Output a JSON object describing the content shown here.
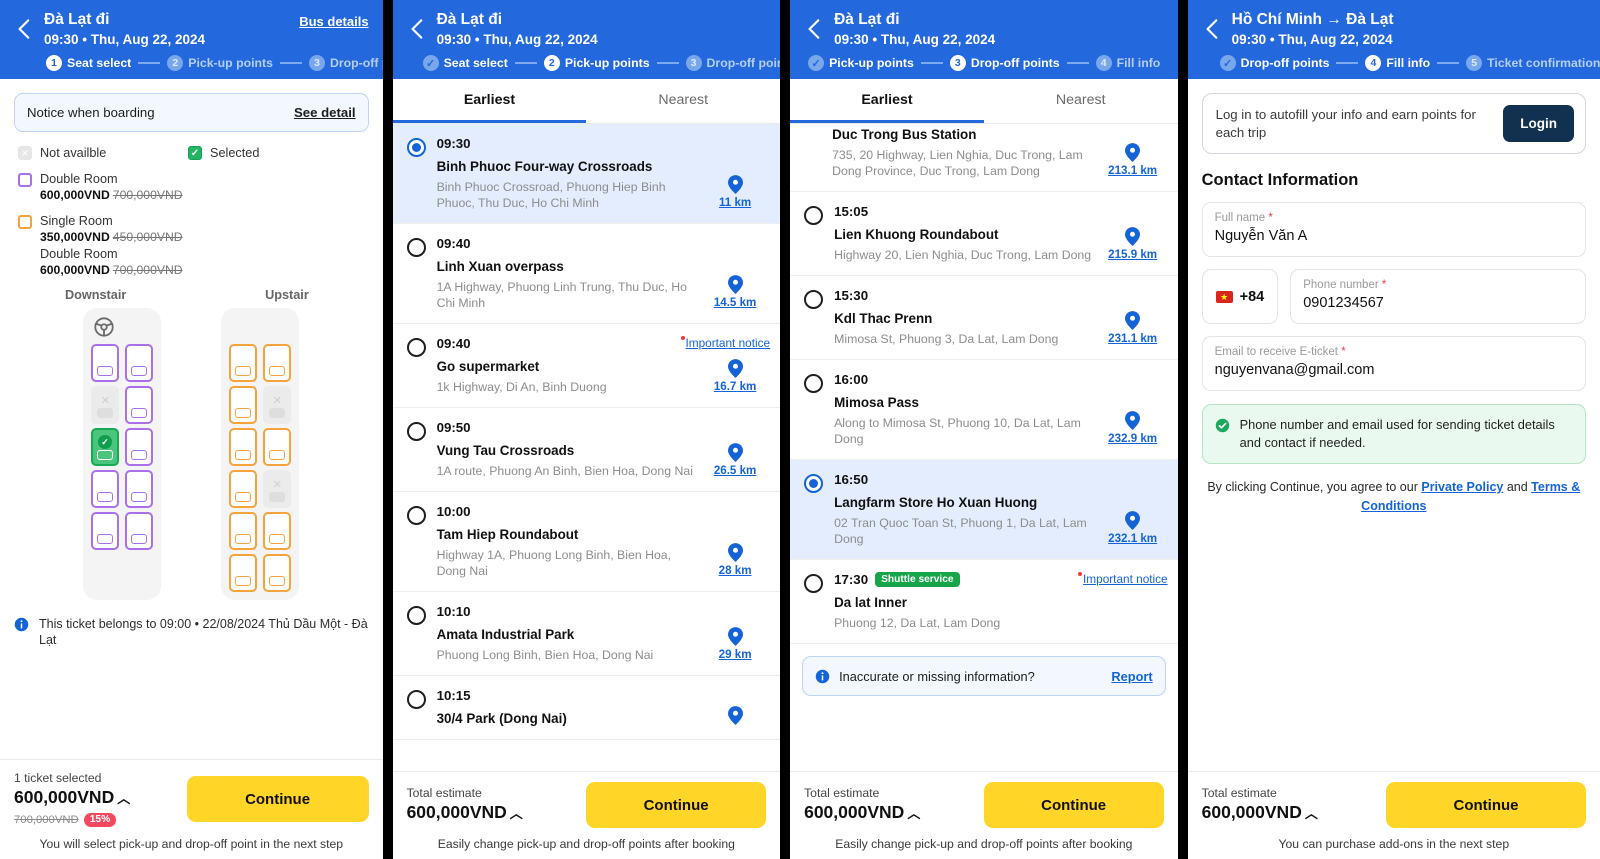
{
  "panel1": {
    "header": {
      "title": "Đà Lạt đi",
      "subtitle": "09:30 • Thu, Aug 22, 2024",
      "action": "Bus details",
      "steps": [
        {
          "num": "1",
          "label": "Seat select",
          "state": "current"
        },
        {
          "num": "2",
          "label": "Pick-up points",
          "state": "todo"
        },
        {
          "num": "3",
          "label": "Drop-off points",
          "state": "todo"
        }
      ]
    },
    "notice": {
      "text": "Notice when boarding",
      "action": "See detail"
    },
    "legend": {
      "not_available": "Not availble",
      "selected": "Selected",
      "groups": [
        {
          "color": "#a970e8",
          "lines": [
            {
              "name": "Double Room",
              "price": "600,000VND",
              "old_price": "700,000VND"
            }
          ]
        },
        {
          "color": "#f5a33c",
          "lines": [
            {
              "name": "Single Room",
              "price": "350,000VND",
              "old_price": "450,000VND"
            },
            {
              "name": "Double Room",
              "price": "600,000VND",
              "old_price": "700,000VND"
            }
          ]
        }
      ]
    },
    "decks": {
      "downstair_label": "Downstair",
      "upstair_label": "Upstair",
      "downstair": [
        [
          "free",
          "free"
        ],
        [
          "na",
          "free"
        ],
        [
          "selected",
          "free"
        ],
        [
          "free",
          "free"
        ],
        [
          "free",
          "free"
        ]
      ],
      "upstair": [
        [
          "free",
          "free"
        ],
        [
          "free",
          "na"
        ],
        [
          "free",
          "free"
        ],
        [
          "free",
          "na"
        ],
        [
          "free",
          "free"
        ],
        [
          "free",
          "free"
        ]
      ]
    },
    "ticket_note": "This ticket belongs to 09:00 • 22/08/2024 Thủ Dầu Một - Đà Lạt",
    "footer": {
      "caption": "1 ticket selected",
      "amount": "600,000VND",
      "old_price": "700,000VND",
      "discount": "15%",
      "continue": "Continue",
      "hint": "You will select pick-up and drop-off point in the next step"
    }
  },
  "panel2": {
    "header": {
      "title": "Đà Lạt đi",
      "subtitle": "09:30 • Thu, Aug 22, 2024",
      "steps": [
        {
          "num": "✓",
          "label": "Seat select",
          "state": "done"
        },
        {
          "num": "2",
          "label": "Pick-up points",
          "state": "current"
        },
        {
          "num": "3",
          "label": "Drop-off points",
          "state": "todo"
        }
      ]
    },
    "tabs": [
      {
        "label": "Earliest",
        "active": true
      },
      {
        "label": "Nearest",
        "active": false
      }
    ],
    "stops": [
      {
        "time": "09:30",
        "name": "Binh Phuoc Four-way Crossroads",
        "addr": "Binh Phuoc Crossroad, Phuong Hiep Binh Phuoc, Thu Duc, Ho Chi Minh",
        "dist": "11 km",
        "selected": true
      },
      {
        "time": "09:40",
        "name": "Linh Xuan overpass",
        "addr": "1A Highway, Phuong Linh Trung, Thu Duc, Ho Chi Minh",
        "dist": "14.5 km",
        "selected": false
      },
      {
        "time": "09:40",
        "name": "Go supermarket",
        "addr": "1k Highway, Di An, Binh Duong",
        "dist": "16.7 km",
        "selected": false,
        "notice": "Important notice"
      },
      {
        "time": "09:50",
        "name": "Vung Tau Crossroads",
        "addr": "1A route, Phuong An Binh, Bien Hoa, Dong Nai",
        "dist": "26.5 km",
        "selected": false
      },
      {
        "time": "10:00",
        "name": "Tam Hiep Roundabout",
        "addr": "Highway 1A, Phuong Long Binh, Bien Hoa, Dong Nai",
        "dist": "28 km",
        "selected": false
      },
      {
        "time": "10:10",
        "name": "Amata Industrial Park",
        "addr": "Phuong Long Binh, Bien Hoa, Dong Nai",
        "dist": "29 km",
        "selected": false
      },
      {
        "time": "10:15",
        "name": "30/4 Park (Dong Nai)",
        "addr": "",
        "dist": "",
        "selected": false
      }
    ],
    "footer": {
      "caption": "Total estimate",
      "amount": "600,000VND",
      "continue": "Continue",
      "hint": "Easily change pick-up and drop-off points after booking"
    }
  },
  "panel3": {
    "header": {
      "title": "Đà Lạt đi",
      "subtitle": "09:30 • Thu, Aug 22, 2024",
      "steps": [
        {
          "num": "✓",
          "label": "Pick-up points",
          "state": "done"
        },
        {
          "num": "3",
          "label": "Drop-off points",
          "state": "current"
        },
        {
          "num": "4",
          "label": "Fill info",
          "state": "todo"
        }
      ]
    },
    "tabs": [
      {
        "label": "Earliest",
        "active": true
      },
      {
        "label": "Nearest",
        "active": false
      }
    ],
    "stops": [
      {
        "time": "",
        "name": "Duc Trong Bus Station",
        "addr": "735, 20 Highway, Lien Nghia, Duc Trong, Lam Dong Province, Duc Trong, Lam Dong",
        "dist": "213.1 km",
        "selected": false,
        "clipped": true
      },
      {
        "time": "15:05",
        "name": "Lien Khuong Roundabout",
        "addr": "Highway 20, Lien Nghia, Duc Trong, Lam Dong",
        "dist": "215.9 km",
        "selected": false
      },
      {
        "time": "15:30",
        "name": "Kdl Thac Prenn",
        "addr": "Mimosa St, Phuong 3, Da Lat, Lam Dong",
        "dist": "231.1 km",
        "selected": false
      },
      {
        "time": "16:00",
        "name": "Mimosa Pass",
        "addr": "Along to Mimosa St, Phuong 10, Da Lat, Lam Dong",
        "dist": "232.9 km",
        "selected": false
      },
      {
        "time": "16:50",
        "name": "Langfarm Store Ho Xuan Huong",
        "addr": "02 Tran Quoc Toan St, Phuong 1, Da Lat, Lam Dong",
        "dist": "232.1 km",
        "selected": true
      },
      {
        "time": "17:30",
        "name": "Da lat Inner",
        "addr": "Phuong 12, Da Lat, Lam Dong",
        "dist": "",
        "selected": false,
        "badge": "Shuttle service",
        "notice": "Important notice"
      }
    ],
    "report": {
      "text": "Inaccurate or missing information?",
      "action": "Report"
    },
    "footer": {
      "caption": "Total estimate",
      "amount": "600,000VND",
      "continue": "Continue",
      "hint": "Easily change pick-up and drop-off points after booking"
    }
  },
  "panel4": {
    "header": {
      "title": "Hồ Chí Minh → Đà Lạt",
      "subtitle": "09:30 • Thu, Aug 22, 2024",
      "steps": [
        {
          "num": "✓",
          "label": "Drop-off points",
          "state": "done"
        },
        {
          "num": "4",
          "label": "Fill info",
          "state": "current"
        },
        {
          "num": "5",
          "label": "Ticket confirmation",
          "state": "todo"
        }
      ]
    },
    "login": {
      "text": "Log in to autofill your info and earn points for each trip",
      "button": "Login"
    },
    "section_title": "Contact Information",
    "fields": {
      "full_name": {
        "label": "Full name",
        "value": "Nguyễn Văn A",
        "required": "*"
      },
      "country_code": "+84",
      "phone": {
        "label": "Phone number",
        "value": "0901234567",
        "required": "*"
      },
      "email": {
        "label": "Email to receive E-ticket",
        "value": "nguyenvana@gmail.com",
        "required": "*"
      }
    },
    "green_note": "Phone number and email used for sending ticket details and contact if needed.",
    "agree": {
      "prefix": "By clicking Continue, you agree to our ",
      "link1": "Private Policy",
      "mid": " and ",
      "link2": "Terms & Conditions"
    },
    "footer": {
      "caption": "Total estimate",
      "amount": "600,000VND",
      "continue": "Continue",
      "hint": "You can purchase add-ons in the next step"
    }
  }
}
